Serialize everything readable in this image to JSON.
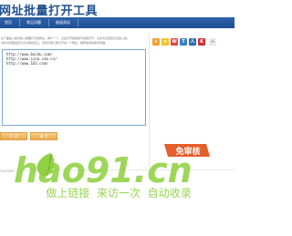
{
  "header": {
    "title": "网址批量打开工具"
  },
  "nav": {
    "items": [
      "首页",
      "常见问题",
      "链接测试"
    ]
  },
  "main": {
    "description_lines": [
      "在下面输入框中输入需要打开的网址，每行一个，点击打开按钮即可批量打开，点击清空按钮清空输入框，",
      "请将浏览器设置为允许弹出窗口，否则可能只能打开第一个网址，推荐使用谷歌浏览器。"
    ],
    "urls": [
      "http://www.baidu.com/",
      "http://www.sina.com.cn/",
      "http://www.163.com/"
    ],
    "open_button": "打 开",
    "clear_button": "清 空"
  },
  "share": {
    "icons": [
      "share-plus-icon",
      "qzone-icon",
      "weibo-icon",
      "tencent-icon",
      "renren-icon",
      "kaixin-icon",
      "more-icon"
    ]
  },
  "footer": {
    "copyright": "Copyright"
  },
  "watermark": {
    "badge": "免审核",
    "logo": "hao91.cn",
    "slogan": "做上链接  来访一次  自动收录"
  }
}
